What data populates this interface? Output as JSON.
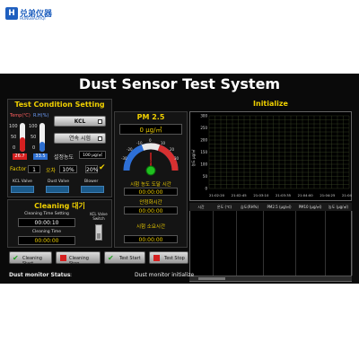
{
  "brand": {
    "logo_letter": "H",
    "name": "兑弟仪器",
    "sub": "HONGBAOYIQI"
  },
  "window": {
    "title": "Dust Sensor Test System"
  },
  "left": {
    "section_title": "Test Condition Setting",
    "temp_label": "Temp(℃)",
    "humid_label": "R.H(%)",
    "temp_scale": [
      "100",
      "50",
      "0"
    ],
    "humid_scale": [
      "100",
      "50",
      "0"
    ],
    "temp_value": "26.7",
    "humid_value": "33.5",
    "kcl_button": "KCL",
    "continuous_button": "연속 시험",
    "setpoint_label": "설정농도",
    "setpoint_value": "100 μg/㎥",
    "factor_label": "Factor",
    "factor_value": "1",
    "error_label": "오차",
    "error_value": "10%",
    "pct_value": "20%",
    "valve_labels": [
      "KCL Valve",
      "Dust Valve",
      "Blower"
    ],
    "cleaning_title": "Cleaning 대기",
    "cleaning_time_setting_label": "Cleaning Time Setting",
    "cleaning_time_setting": "00:00:10",
    "cleaning_time_label": "Cleaning Time",
    "cleaning_time": "00:00:00",
    "kcl_switch_label": "KCL Valve Switch"
  },
  "middle": {
    "pm_title": "PM 2.5",
    "pm_value": "0 μg/㎥",
    "gauge_ticks": [
      "-30",
      "-20",
      "-10",
      "0",
      "10",
      "20",
      "30"
    ],
    "gauge_center_value": "0",
    "reach_time_label": "시험 농도 도달 시간",
    "reach_time": "00:00:00",
    "stable_time_label": "안정화시간",
    "stable_time": "00:00:00",
    "elapsed_time_label": "시험 소요시간",
    "elapsed_time": "00:00:00"
  },
  "right": {
    "initialize_title": "Initialize",
    "y_axis_label": "농도 μg/㎥",
    "y_ticks": [
      "300",
      "250",
      "200",
      "150",
      "100",
      "50",
      "0"
    ],
    "x_ticks": [
      "21:02:20",
      "21:02:45",
      "21:03:10",
      "21:03:35",
      "21:04:00",
      "21:04:25",
      "21:04:50"
    ],
    "table_columns": [
      "시간",
      "온도 (℃)",
      "습도(RH%)",
      "PM2.5 (μg/㎥)",
      "PM10 (μg/㎥)",
      "농도 (μg/㎥)"
    ]
  },
  "bottom_buttons": [
    "Cleaning Start",
    "Cleaning Stop",
    "Test Start",
    "Test Stop"
  ],
  "status": {
    "left_label": "Dust monitor Status",
    "left_sep": ":",
    "right_label": "Dust monitor initialize"
  },
  "colors": {
    "accent_yellow": "#f0d000",
    "panel_bg": "#141414",
    "temp_red": "#d52020",
    "humid_blue": "#2e6fd0",
    "led_green": "#20c020"
  }
}
